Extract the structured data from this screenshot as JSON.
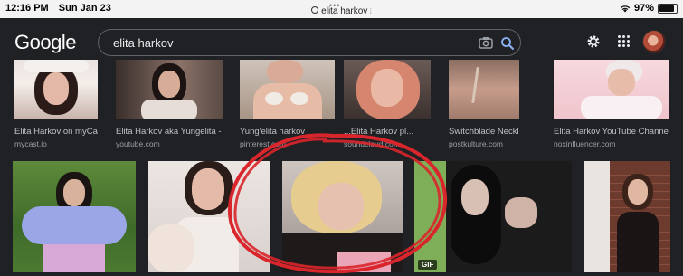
{
  "status_bar": {
    "time": "12:16 PM",
    "date": "Sun Jan 23",
    "url": "elita harkov",
    "battery": "97%",
    "battery_level": 0.97
  },
  "header": {
    "logo_text": "Google",
    "search_value": "elita harkov",
    "icons": [
      "camera-icon",
      "search-icon",
      "gear-icon",
      "apps-icon",
      "avatar"
    ]
  },
  "results_row1": [
    {
      "caption": "Elita Harkov on myCast...",
      "source": "mycast.io"
    },
    {
      "caption": "Elita Harkov aka Yungelita - Y...",
      "source": "youtube.com"
    },
    {
      "caption": "Yung'elita harkov",
      "source": "pinterest.com"
    },
    {
      "caption": "...Elita Harkov pl...",
      "source": "soundcloud.com"
    },
    {
      "caption": "Switchblade Necklace, ...",
      "source": "postkulture.com"
    },
    {
      "caption": "Elita Harkov YouTube Channel A...",
      "source": "noxinfluencer.com"
    }
  ],
  "results_row2": [
    {
      "badge": ""
    },
    {
      "badge": ""
    },
    {
      "badge": ""
    },
    {
      "badge": "GIF"
    },
    {
      "badge": ""
    }
  ],
  "colors": {
    "background": "#202124",
    "annotation": "#d9262c"
  }
}
